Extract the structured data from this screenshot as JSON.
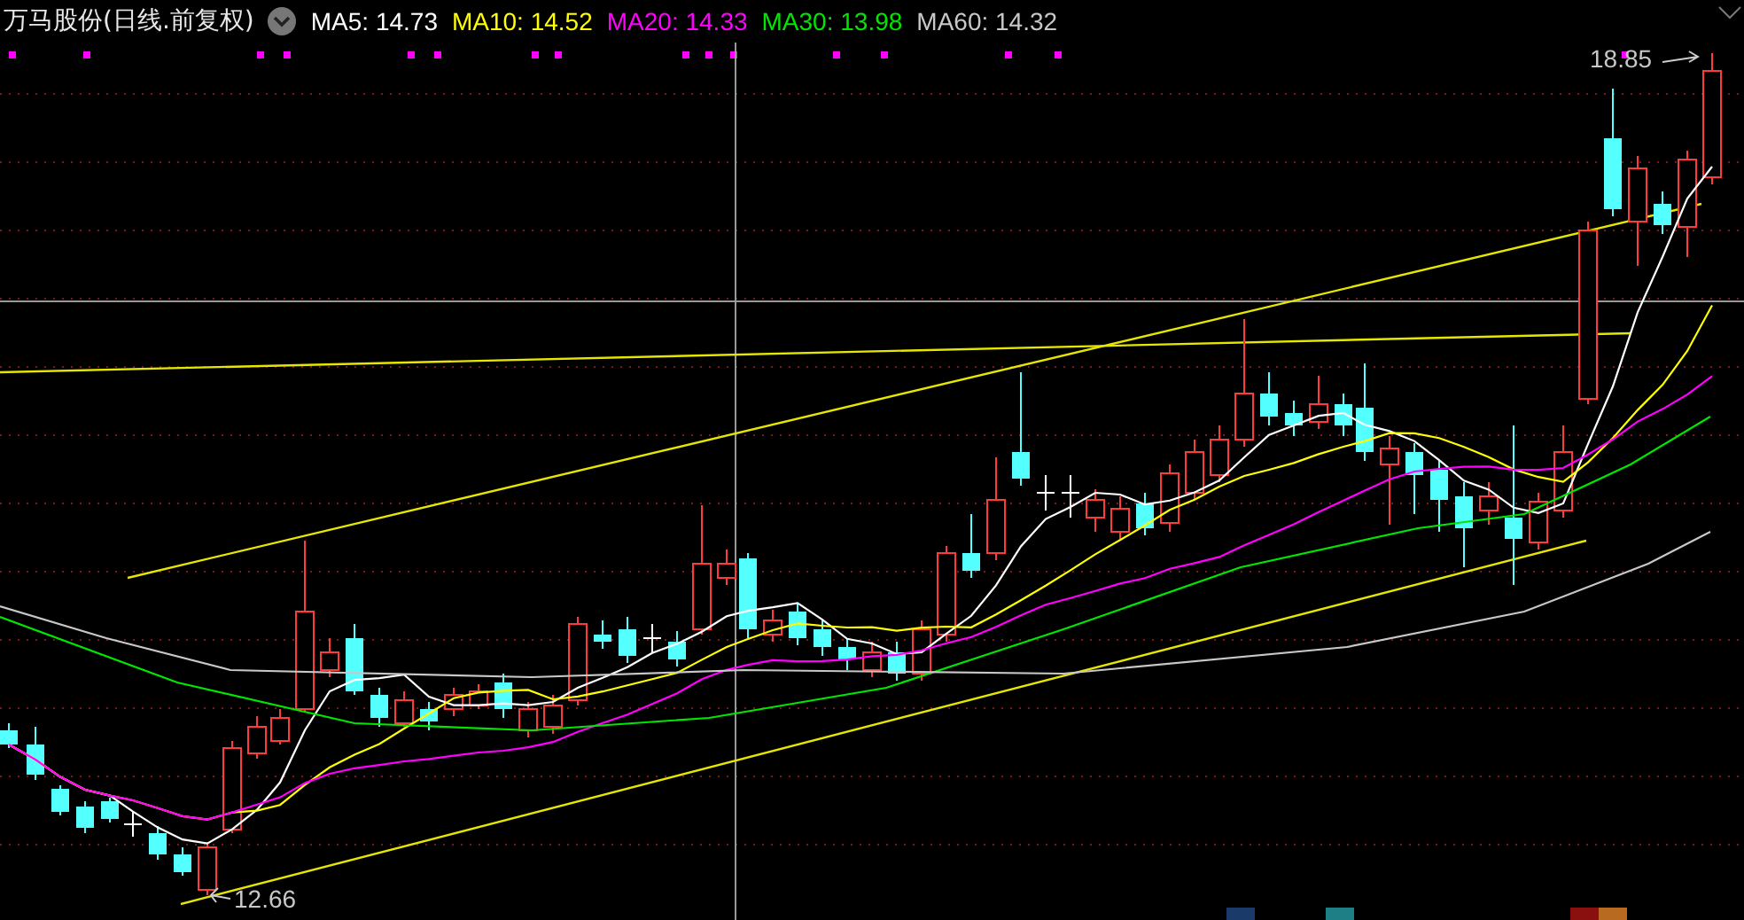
{
  "header": {
    "title": "万马股份(日线.前复权)",
    "indicators": [
      {
        "label": "MA5: 14.73",
        "color": "#ffffff"
      },
      {
        "label": "MA10: 14.52",
        "color": "#ffff00"
      },
      {
        "label": "MA20: 14.33",
        "color": "#ff00ff"
      },
      {
        "label": "MA30: 13.98",
        "color": "#00e600"
      },
      {
        "label": "MA60: 14.32",
        "color": "#c8c8c8"
      }
    ]
  },
  "chart": {
    "high_label": "18.85",
    "low_label": "12.66"
  }
}
